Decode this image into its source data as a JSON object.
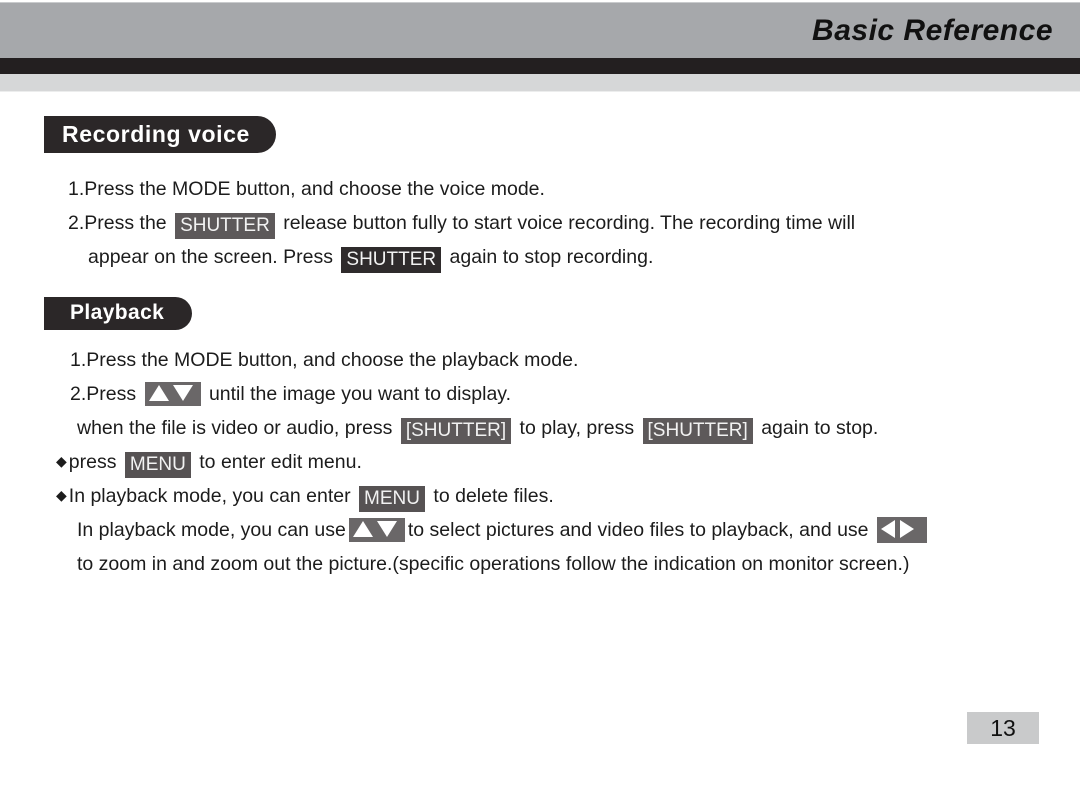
{
  "header": {
    "title": "Basic Reference"
  },
  "sections": [
    {
      "id": "recording-voice",
      "heading": "Recording  voice",
      "lines": [
        {
          "parts": [
            {
              "type": "text",
              "text": "1.Press the MODE button, and choose the voice mode."
            }
          ]
        },
        {
          "parts": [
            {
              "type": "text",
              "text": "2.Press the "
            },
            {
              "type": "key",
              "style": "gray",
              "text": "SHUTTER"
            },
            {
              "type": "text",
              "text": " release button fully to start voice recording. The recording time will"
            }
          ]
        },
        {
          "indent": "indent1",
          "parts": [
            {
              "type": "text",
              "text": "appear on the screen. Press "
            },
            {
              "type": "key",
              "style": "dark",
              "text": "SHUTTER"
            },
            {
              "type": "text",
              "text": " again to stop recording."
            }
          ]
        }
      ]
    },
    {
      "id": "playback",
      "heading": "Playback",
      "lines": [
        {
          "indent": "indent2",
          "parts": [
            {
              "type": "text",
              "text": "1.Press the MODE button, and choose the playback mode."
            }
          ]
        },
        {
          "indent": "indent2",
          "parts": [
            {
              "type": "text",
              "text": "2.Press "
            },
            {
              "type": "icon",
              "icon": "up-down-arrows-icon"
            },
            {
              "type": "text",
              "text": "  until the image you want to display."
            }
          ]
        },
        {
          "indent": "indent3",
          "parts": [
            {
              "type": "text",
              "text": "when the file is video or audio, press "
            },
            {
              "type": "key",
              "style": "gray",
              "text": "[SHUTTER]"
            },
            {
              "type": "text",
              "text": " to play, press "
            },
            {
              "type": "key",
              "style": "gray",
              "text": "[SHUTTER]"
            },
            {
              "type": "text",
              "text": " again to stop."
            }
          ]
        },
        {
          "parts": [
            {
              "type": "bullet",
              "text": "◆"
            },
            {
              "type": "text",
              "text": "press "
            },
            {
              "type": "key",
              "style": "mid",
              "text": "MENU"
            },
            {
              "type": "text",
              "text": " to enter edit menu."
            }
          ]
        },
        {
          "parts": [
            {
              "type": "bullet",
              "text": "◆"
            },
            {
              "type": "text",
              "text": "In playback mode, you can enter "
            },
            {
              "type": "key",
              "style": "mid",
              "text": "MENU"
            },
            {
              "type": "text",
              "text": " to delete files."
            }
          ]
        },
        {
          "indent": "indent3",
          "parts": [
            {
              "type": "text",
              "text": "In playback mode, you can use"
            },
            {
              "type": "icon",
              "icon": "up-down-arrows-icon"
            },
            {
              "type": "text",
              "text": "to select pictures and video files to playback, and use "
            },
            {
              "type": "icon",
              "icon": "left-right-arrows-icon"
            }
          ]
        },
        {
          "indent": "indent3",
          "parts": [
            {
              "type": "text",
              "text": "to zoom in and zoom out the picture.(specific operations follow the indication on monitor screen.)"
            }
          ]
        }
      ]
    }
  ],
  "footer": {
    "page_number": "13"
  },
  "colors": {
    "header_band": "#a6a8ab",
    "header_dark_band": "#231f20",
    "header_light_band": "#d6d7d8",
    "pill_bg": "#2b2728",
    "key_gray": "#5d595a",
    "key_dark": "#2f2b2c",
    "icon_box": "#6a6768",
    "page_number_bg": "#c9cacb"
  }
}
